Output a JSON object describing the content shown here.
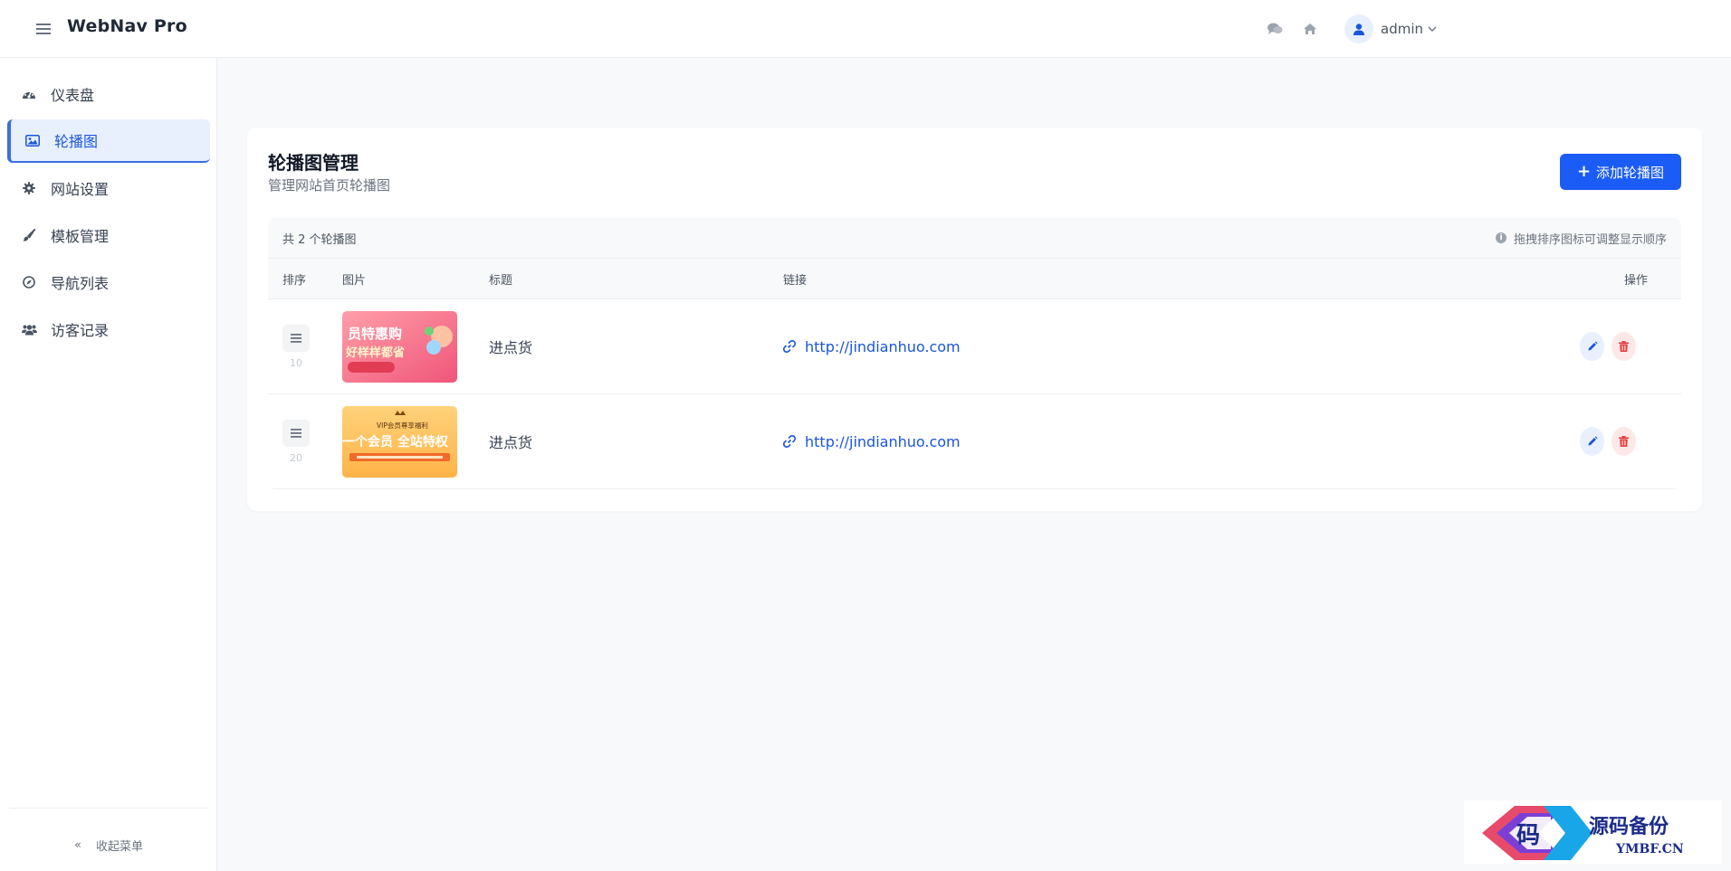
{
  "header": {
    "brand": "WebNav Pro",
    "username": "admin"
  },
  "sidebar": {
    "items": [
      {
        "label": "仪表盘"
      },
      {
        "label": "轮播图"
      },
      {
        "label": "网站设置"
      },
      {
        "label": "模板管理"
      },
      {
        "label": "导航列表"
      },
      {
        "label": "访客记录"
      }
    ],
    "collapse_label": "收起菜单"
  },
  "main": {
    "title": "轮播图管理",
    "subtitle": "管理网站首页轮播图",
    "add_button": "添加轮播图",
    "count_text": "共 2 个轮播图",
    "tip": "拖拽排序图标可调整显示顺序",
    "columns": [
      "排序",
      "图片",
      "标题",
      "链接",
      "操作"
    ],
    "rows": [
      {
        "sort": "10",
        "image_text": "员特惠购 好样样都省",
        "title": "进点货",
        "link": "http://jindianhuo.com"
      },
      {
        "sort": "20",
        "image_text": "VIP会员尊享福利 一个会员 全站特权",
        "title": "进点货",
        "link": "http://jindianhuo.com"
      }
    ]
  },
  "watermark": {
    "logo_char": "码",
    "cn": "源码备份",
    "en": "YMBF.CN"
  },
  "colors": {
    "primary": "#1a5cf5",
    "link": "#1a56db",
    "danger": "#e53e3e"
  }
}
